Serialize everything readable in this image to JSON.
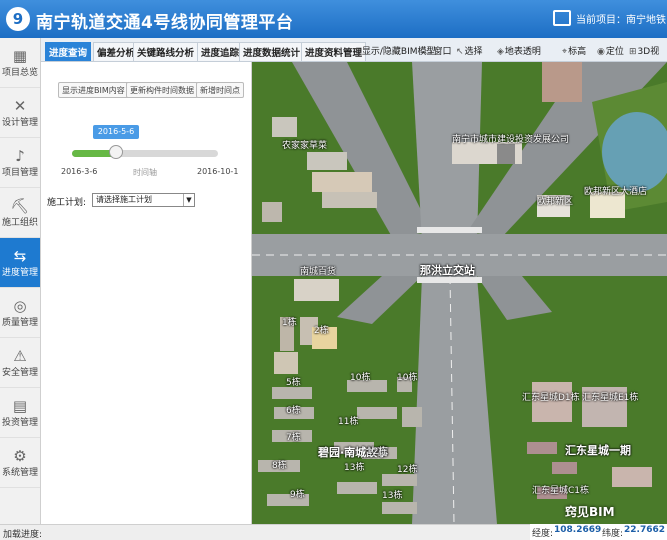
{
  "header": {
    "title": "南宁轨道交通4号线协同管理平台",
    "current_project_label": "当前项目：南宁地铁"
  },
  "sidebar": {
    "items": [
      {
        "label": "项目总览",
        "icon": "▦"
      },
      {
        "label": "设计管理",
        "icon": "✕"
      },
      {
        "label": "项目管理",
        "icon": "♪"
      },
      {
        "label": "施工组织",
        "icon": "⛏"
      },
      {
        "label": "进度管理",
        "icon": "⇆"
      },
      {
        "label": "质量管理",
        "icon": "◎"
      },
      {
        "label": "安全管理",
        "icon": "⚠"
      },
      {
        "label": "投资管理",
        "icon": "▤"
      },
      {
        "label": "系统管理",
        "icon": "⚙"
      }
    ],
    "active_index": 4
  },
  "footer": {
    "progress_label": "加载进度:"
  },
  "tabs": [
    {
      "label": "进度查询"
    },
    {
      "label": "偏差分析"
    },
    {
      "label": "关键路线分析"
    },
    {
      "label": "进度追踪"
    },
    {
      "label": "进度数据统计"
    },
    {
      "label": "进度资料管理"
    }
  ],
  "toolbar": [
    {
      "icon": "◎",
      "label": "显示/隐藏BIM模型"
    },
    {
      "icon": "▭",
      "label": "窗口"
    },
    {
      "icon": "↖",
      "label": "选择"
    },
    {
      "icon": "◈",
      "label": "地表透明"
    },
    {
      "icon": "⌖",
      "label": "标高"
    },
    {
      "icon": "◉",
      "label": "定位"
    },
    {
      "icon": "⊞",
      "label": "3D视"
    }
  ],
  "panel": {
    "buttons": [
      "显示进度BIM内容",
      "更新构件时间数据",
      "新增时间点"
    ],
    "slider": {
      "tooltip": "2016-5-6",
      "start": "2016-3-6",
      "mid": "时间轴",
      "end": "2016-10-1",
      "progress": 0.3
    },
    "plan_label": "施工计划:",
    "plan_select": "请选择施工计划"
  },
  "map": {
    "labels": [
      {
        "text": "农家家草菜"
      },
      {
        "text": "南宁市城市建设投资发展公司"
      },
      {
        "text": "欧邦新区"
      },
      {
        "text": "欧邦新区大酒店"
      },
      {
        "text": "南城百货"
      },
      {
        "text": "那洪立交站",
        "big": true
      },
      {
        "text": "碧园·南城故事",
        "big": true
      },
      {
        "text": "汇东星城一期",
        "big": true
      },
      {
        "text": "汇东星城D1栋"
      },
      {
        "text": "汇东星城E1栋"
      },
      {
        "text": "汇东星城C1栋"
      },
      {
        "text": "5栋"
      },
      {
        "text": "6栋"
      },
      {
        "text": "7栋"
      },
      {
        "text": "8栋"
      },
      {
        "text": "9栋"
      },
      {
        "text": "10栋"
      },
      {
        "text": "11栋"
      },
      {
        "text": "12栋"
      },
      {
        "text": "13栋"
      },
      {
        "text": "12栋"
      },
      {
        "text": "13栋"
      },
      {
        "text": "10栋"
      },
      {
        "text": "1栋"
      },
      {
        "text": "2栋"
      }
    ]
  },
  "status": {
    "lon_label": "经度:",
    "lon_value": "108.2669",
    "lat_label": "纬度:",
    "lat_value": "22.7662"
  },
  "watermark": "窍见BIM"
}
